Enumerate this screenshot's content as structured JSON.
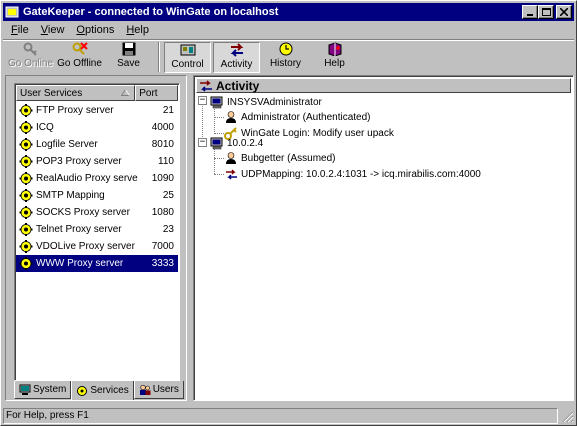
{
  "window": {
    "title": "GateKeeper - connected to WinGate on localhost"
  },
  "menu": {
    "items": [
      {
        "label": "File",
        "accel": "F",
        "rest": "ile"
      },
      {
        "label": "View",
        "accel": "V",
        "rest": "iew"
      },
      {
        "label": "Options",
        "accel": "O",
        "rest": "ptions"
      },
      {
        "label": "Help",
        "accel": "H",
        "rest": "elp"
      }
    ]
  },
  "toolbar": {
    "buttons": [
      {
        "label": "Go Online",
        "icon": "key-icon",
        "state": "disabled"
      },
      {
        "label": "Go Offline",
        "icon": "key-cross-icon",
        "state": "normal"
      },
      {
        "label": "Save",
        "icon": "floppy-disk-icon",
        "state": "normal"
      },
      {
        "label": "Control",
        "icon": "control-panel-icon",
        "state": "pressed"
      },
      {
        "label": "Activity",
        "icon": "activity-arrows-icon",
        "state": "pressed"
      },
      {
        "label": "History",
        "icon": "clock-icon",
        "state": "normal"
      },
      {
        "label": "Help",
        "icon": "help-book-icon",
        "state": "normal"
      }
    ]
  },
  "services": {
    "header_name": "User Services",
    "header_port": "Port",
    "rows": [
      {
        "name": "FTP Proxy server",
        "port": "21"
      },
      {
        "name": "ICQ",
        "port": "4000"
      },
      {
        "name": "Logfile Server",
        "port": "8010"
      },
      {
        "name": "POP3 Proxy server",
        "port": "110"
      },
      {
        "name": "RealAudio Proxy server",
        "port": "1090"
      },
      {
        "name": "SMTP Mapping",
        "port": "25"
      },
      {
        "name": "SOCKS Proxy server",
        "port": "1080"
      },
      {
        "name": "Telnet Proxy server",
        "port": "23"
      },
      {
        "name": "VDOLive Proxy server",
        "port": "7000"
      },
      {
        "name": "WWW Proxy server",
        "port": "3333",
        "selected": true
      }
    ],
    "tabs": [
      {
        "label": "System",
        "icon": "computer-icon"
      },
      {
        "label": "Services",
        "icon": "gear-icon",
        "active": true
      },
      {
        "label": "Users",
        "icon": "users-icon"
      }
    ]
  },
  "activity": {
    "title": "Activity",
    "nodes": [
      {
        "label": "INSYSVAdministrator"
      },
      {
        "label": "Administrator (Authenticated)"
      },
      {
        "label": "WinGate Login: Modify user upack"
      },
      {
        "label": "10.0.2.4"
      },
      {
        "label": "Bubgetter (Assumed)"
      },
      {
        "label": "UDPMapping: 10.0.2.4:1031 -> icq.mirabilis.com:4000"
      }
    ]
  },
  "status": {
    "text": "For Help, press F1"
  },
  "colors": {
    "titlebar": "#000080",
    "face": "#c0c0c0",
    "selection": "#000080"
  }
}
